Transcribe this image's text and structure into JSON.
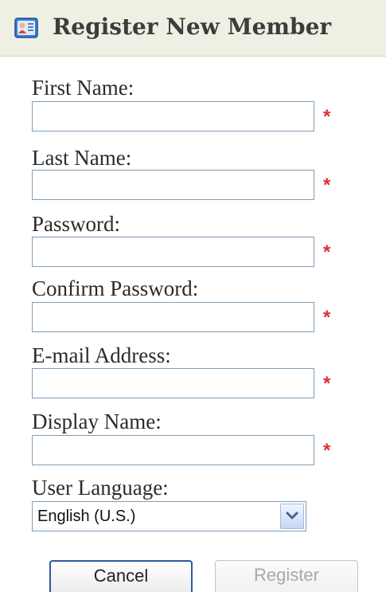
{
  "header": {
    "title": "Register New Member",
    "icon": "member-card-icon"
  },
  "form": {
    "fields": [
      {
        "label": "First Name:",
        "value": "",
        "required": true
      },
      {
        "label": "Last Name:",
        "value": "",
        "required": true
      },
      {
        "label": "Password:",
        "value": "",
        "required": true
      },
      {
        "label": "Confirm Password:",
        "value": "",
        "required": true
      },
      {
        "label": "E-mail Address:",
        "value": "",
        "required": true
      },
      {
        "label": "Display Name:",
        "value": "",
        "required": true
      }
    ],
    "required_marker": "*",
    "language": {
      "label": "User Language:",
      "selected": "English (U.S.)"
    }
  },
  "buttons": {
    "cancel": "Cancel",
    "register": "Register"
  },
  "colors": {
    "required": "#e03030",
    "input_border": "#7f9db9",
    "header_bg": "#eef0e4"
  }
}
